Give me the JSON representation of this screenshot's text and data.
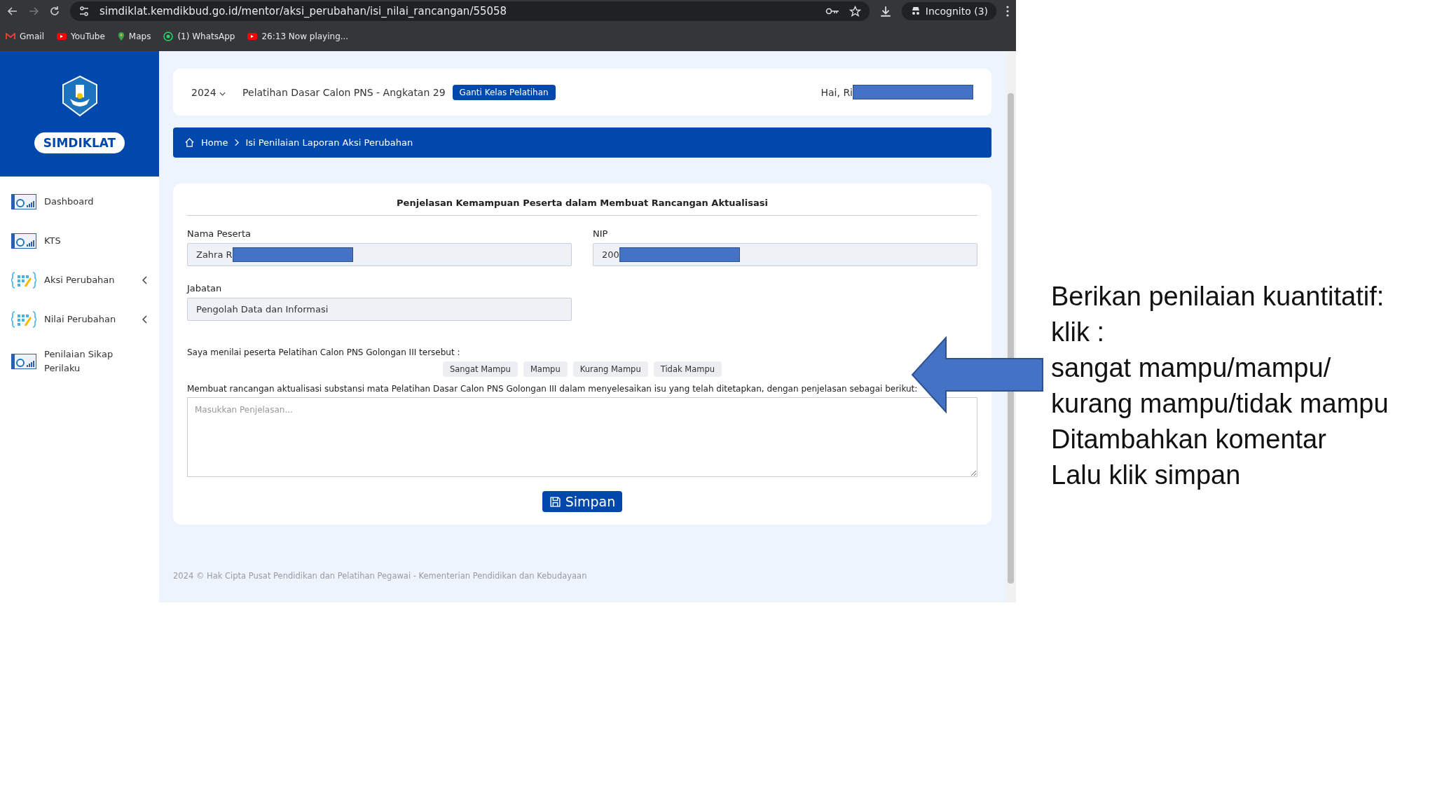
{
  "browser": {
    "url": "simdiklat.kemdikbud.go.id/mentor/aksi_perubahan/isi_nilai_rancangan/55058",
    "profile": "Incognito (3)",
    "bookmarks": [
      {
        "label": "Gmail",
        "kind": "mail"
      },
      {
        "label": "YouTube",
        "kind": "video"
      },
      {
        "label": "Maps",
        "kind": "map"
      },
      {
        "label": "(1) WhatsApp",
        "kind": "chat"
      },
      {
        "label": "26:13 Now playing...",
        "kind": "video"
      }
    ]
  },
  "sidebar": {
    "brand": "SIMDIKLAT",
    "items": [
      {
        "label": "Dashboard",
        "kind": "chart",
        "expandable": false
      },
      {
        "label": "KTS",
        "kind": "chart",
        "expandable": false
      },
      {
        "label": "Aksi Perubahan",
        "kind": "code",
        "expandable": true
      },
      {
        "label": "Nilai Perubahan",
        "kind": "code",
        "expandable": true
      },
      {
        "label": "Penilaian Sikap Perilaku",
        "kind": "chart",
        "expandable": false
      }
    ]
  },
  "topbar": {
    "year": "2024",
    "class_name": "Pelatihan Dasar Calon PNS - Angkatan 29",
    "change_button": "Ganti Kelas Pelatihan",
    "greeting": "Hai, Ri"
  },
  "breadcrumb": [
    "Home",
    "Isi Penilaian Laporan Aksi Perubahan"
  ],
  "form": {
    "title": "Penjelasan Kemampuan Peserta dalam Membuat Rancangan Aktualisasi",
    "fields": [
      {
        "label": "Nama Peserta",
        "value": "Zahra R",
        "redacted": true
      },
      {
        "label": "NIP",
        "value": "200",
        "redacted": true
      },
      {
        "label": "Jabatan",
        "value": "Pengolah Data dan Informasi",
        "redacted": false
      }
    ],
    "rating_prompt": "Saya menilai peserta Pelatihan Calon PNS Golongan III tersebut :",
    "ratings": [
      {
        "label": "Sangat Mampu",
        "selected": false
      },
      {
        "label": "Mampu",
        "selected": false
      },
      {
        "label": "Kurang Mampu",
        "selected": false
      },
      {
        "label": "Tidak Mampu",
        "selected": false
      }
    ],
    "explanation_label": "Membuat rancangan aktualisasi substansi mata Pelatihan Dasar Calon PNS Golongan III dalam menyelesaikan isu yang telah ditetapkan, dengan penjelasan sebagai berikut:",
    "explanation_placeholder": "Masukkan Penjelasan...",
    "save_button": "Simpan"
  },
  "footer": "2024 © Hak Cipta Pusat Pendidikan dan Pelatihan Pegawai - Kementerian Pendidikan dan Kebudayaan",
  "annotation": [
    "Berikan penilaian kuantitatif:",
    "klik :",
    "sangat mampu/mampu/",
    "kurang mampu/tidak mampu",
    "Ditambahkan komentar",
    "Lalu klik simpan"
  ]
}
